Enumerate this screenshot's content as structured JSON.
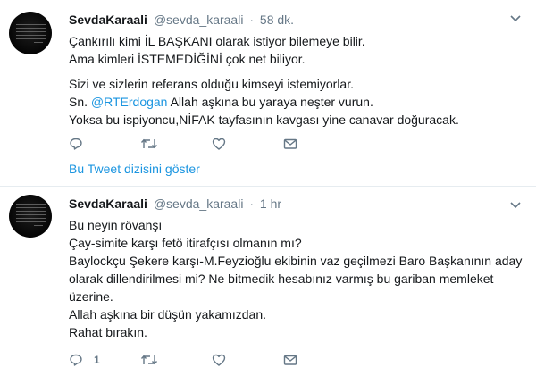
{
  "tweets": [
    {
      "name": "SevdaKaraali",
      "handle": "@sevda_karaali",
      "separator": "·",
      "time": "58 dk.",
      "lines": [
        "Çankırılı kimi  İL BAŞKANI olarak istiyor bilemeye bilir.",
        "Ama kimleri İSTEMEDİĞİNİ çok net biliyor.",
        "",
        "Sizi ve sizlerin referans olduğu kimseyi istemiyorlar.",
        "Allah aşkına bu yaraya neşter vurun.",
        "Yoksa bu ispiyoncu,NİFAK tayfasının kavgası yine canavar doğuracak."
      ],
      "mention_prefix": "Sn. ",
      "mention": "@RTErdogan",
      "thread_link": "Bu Tweet dizisini göster"
    },
    {
      "name": "SevdaKaraali",
      "handle": "@sevda_karaali",
      "separator": "·",
      "time": "1 hr",
      "lines": [
        "Bu neyin rövanşı",
        "Çay-simite karşı fetö itirafçısı olmanın mı?",
        "Baylockçu Şekere karşı-M.Feyzioğlu ekibinin vaz geçilmezi Baro Başkanının aday",
        "olarak dillendirilmesi mi? Ne bitmedik hesabınız varmış bu gariban memleket",
        "üzerine.",
        "Allah aşkına bir düşün yakamızdan.",
        "Rahat bırakın."
      ],
      "reply_count": "1"
    }
  ],
  "icons": {
    "reply": "reply-icon",
    "retweet": "retweet-icon",
    "like": "heart-icon",
    "dm": "envelope-icon",
    "caret": "chevron-down-icon"
  },
  "colors": {
    "link": "#1b95e0",
    "muted": "#657786",
    "text": "#14171a",
    "divider": "#e6ecf0"
  }
}
